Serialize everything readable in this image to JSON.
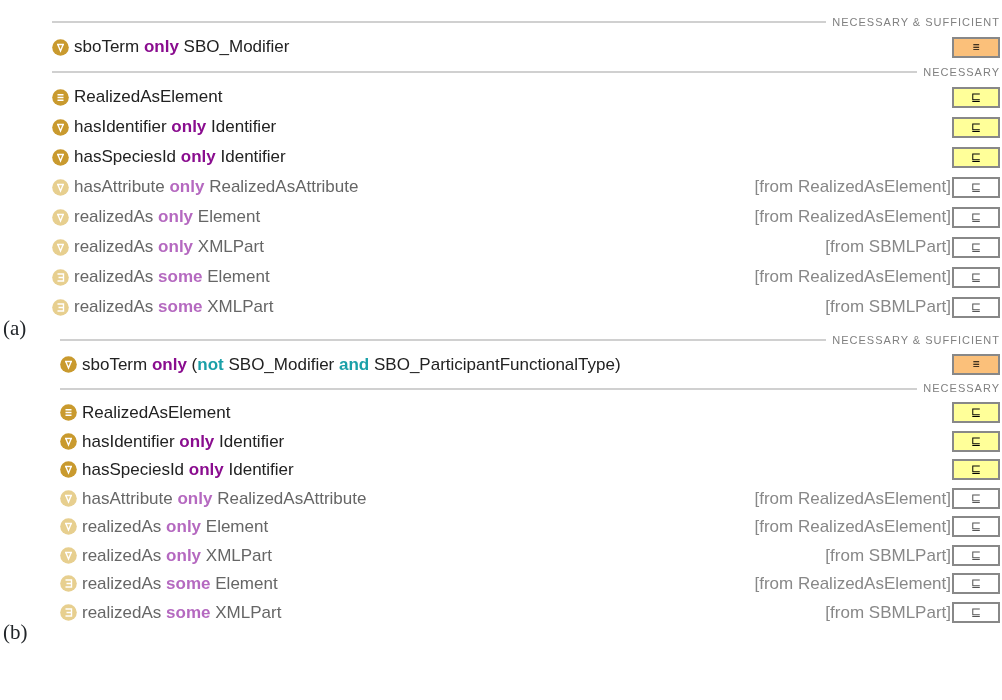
{
  "panels": [
    {
      "label": "(a)",
      "sections": [
        {
          "title": "NECESSARY & SUFFICIENT",
          "kind": "equivalent",
          "rows": [
            {
              "kind": "only",
              "inherited": false,
              "tokens": [
                {
                  "text": "sboTerm",
                  "kind": "plain"
                },
                {
                  "text": "only",
                  "kind": "quantifier"
                },
                {
                  "text": "SBO_Modifier",
                  "kind": "plain"
                }
              ],
              "button": "≡"
            }
          ]
        },
        {
          "title": "NECESSARY",
          "kind": "subclass",
          "rows": [
            {
              "kind": "class",
              "inherited": false,
              "tokens": [
                {
                  "text": "RealizedAsElement",
                  "kind": "plain"
                }
              ],
              "button": "⊑"
            },
            {
              "kind": "only",
              "inherited": false,
              "tokens": [
                {
                  "text": "hasIdentifier",
                  "kind": "plain"
                },
                {
                  "text": "only",
                  "kind": "quantifier"
                },
                {
                  "text": "Identifier",
                  "kind": "plain"
                }
              ],
              "button": "⊑"
            },
            {
              "kind": "only",
              "inherited": false,
              "tokens": [
                {
                  "text": "hasSpeciesId",
                  "kind": "plain"
                },
                {
                  "text": "only",
                  "kind": "quantifier"
                },
                {
                  "text": "Identifier",
                  "kind": "plain"
                }
              ],
              "button": "⊑"
            },
            {
              "kind": "only",
              "inherited": true,
              "tokens": [
                {
                  "text": "hasAttribute",
                  "kind": "plain"
                },
                {
                  "text": "only",
                  "kind": "quantifier"
                },
                {
                  "text": "RealizedAsAttribute",
                  "kind": "plain"
                }
              ],
              "origin": "[from RealizedAsElement]",
              "button": "⊑"
            },
            {
              "kind": "only",
              "inherited": true,
              "tokens": [
                {
                  "text": "realizedAs",
                  "kind": "plain"
                },
                {
                  "text": "only",
                  "kind": "quantifier"
                },
                {
                  "text": "Element",
                  "kind": "plain"
                }
              ],
              "origin": "[from RealizedAsElement]",
              "button": "⊑"
            },
            {
              "kind": "only",
              "inherited": true,
              "tokens": [
                {
                  "text": "realizedAs",
                  "kind": "plain"
                },
                {
                  "text": "only",
                  "kind": "quantifier"
                },
                {
                  "text": "XMLPart",
                  "kind": "plain"
                }
              ],
              "origin": "[from SBMLPart]",
              "button": "⊑"
            },
            {
              "kind": "some",
              "inherited": true,
              "tokens": [
                {
                  "text": "realizedAs",
                  "kind": "plain"
                },
                {
                  "text": "some",
                  "kind": "quantifier"
                },
                {
                  "text": "Element",
                  "kind": "plain"
                }
              ],
              "origin": "[from RealizedAsElement]",
              "button": "⊑"
            },
            {
              "kind": "some",
              "inherited": true,
              "tokens": [
                {
                  "text": "realizedAs",
                  "kind": "plain"
                },
                {
                  "text": "some",
                  "kind": "quantifier"
                },
                {
                  "text": "XMLPart",
                  "kind": "plain"
                }
              ],
              "origin": "[from SBMLPart]",
              "button": "⊑"
            }
          ]
        }
      ]
    },
    {
      "label": "(b)",
      "sections": [
        {
          "title": "NECESSARY & SUFFICIENT",
          "kind": "equivalent",
          "rows": [
            {
              "kind": "only",
              "inherited": false,
              "tokens": [
                {
                  "text": "sboTerm",
                  "kind": "plain"
                },
                {
                  "text": "only",
                  "kind": "quantifier"
                },
                {
                  "text": "(",
                  "kind": "paren-open"
                },
                {
                  "text": "not",
                  "kind": "logical"
                },
                {
                  "text": "SBO_Modifier",
                  "kind": "plain"
                },
                {
                  "text": "and",
                  "kind": "logical"
                },
                {
                  "text": "SBO_ParticipantFunctionalType)",
                  "kind": "plain"
                }
              ],
              "button": "≡"
            }
          ]
        },
        {
          "title": "NECESSARY",
          "kind": "subclass",
          "rows": [
            {
              "kind": "class",
              "inherited": false,
              "tokens": [
                {
                  "text": "RealizedAsElement",
                  "kind": "plain"
                }
              ],
              "button": "⊑"
            },
            {
              "kind": "only",
              "inherited": false,
              "tokens": [
                {
                  "text": "hasIdentifier",
                  "kind": "plain"
                },
                {
                  "text": "only",
                  "kind": "quantifier"
                },
                {
                  "text": "Identifier",
                  "kind": "plain"
                }
              ],
              "button": "⊑"
            },
            {
              "kind": "only",
              "inherited": false,
              "tokens": [
                {
                  "text": "hasSpeciesId",
                  "kind": "plain"
                },
                {
                  "text": "only",
                  "kind": "quantifier"
                },
                {
                  "text": "Identifier",
                  "kind": "plain"
                }
              ],
              "button": "⊑"
            },
            {
              "kind": "only",
              "inherited": true,
              "tokens": [
                {
                  "text": "hasAttribute",
                  "kind": "plain"
                },
                {
                  "text": "only",
                  "kind": "quantifier"
                },
                {
                  "text": "RealizedAsAttribute",
                  "kind": "plain"
                }
              ],
              "origin": "[from RealizedAsElement]",
              "button": "⊑"
            },
            {
              "kind": "only",
              "inherited": true,
              "tokens": [
                {
                  "text": "realizedAs",
                  "kind": "plain"
                },
                {
                  "text": "only",
                  "kind": "quantifier"
                },
                {
                  "text": "Element",
                  "kind": "plain"
                }
              ],
              "origin": "[from RealizedAsElement]",
              "button": "⊑"
            },
            {
              "kind": "only",
              "inherited": true,
              "tokens": [
                {
                  "text": "realizedAs",
                  "kind": "plain"
                },
                {
                  "text": "only",
                  "kind": "quantifier"
                },
                {
                  "text": "XMLPart",
                  "kind": "plain"
                }
              ],
              "origin": "[from SBMLPart]",
              "button": "⊑"
            },
            {
              "kind": "some",
              "inherited": true,
              "tokens": [
                {
                  "text": "realizedAs",
                  "kind": "plain"
                },
                {
                  "text": "some",
                  "kind": "quantifier"
                },
                {
                  "text": "Element",
                  "kind": "plain"
                }
              ],
              "origin": "[from RealizedAsElement]",
              "button": "⊑"
            },
            {
              "kind": "some",
              "inherited": true,
              "tokens": [
                {
                  "text": "realizedAs",
                  "kind": "plain"
                },
                {
                  "text": "some",
                  "kind": "quantifier"
                },
                {
                  "text": "XMLPart",
                  "kind": "plain"
                }
              ],
              "origin": "[from SBMLPart]",
              "button": "⊑"
            }
          ]
        }
      ]
    }
  ]
}
